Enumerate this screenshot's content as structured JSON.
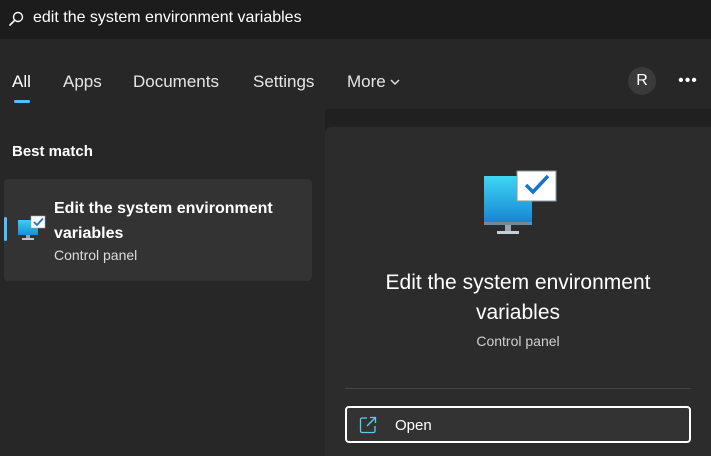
{
  "search": {
    "query": "edit the system environment variables",
    "icon": "search-icon"
  },
  "tabs": {
    "items": [
      {
        "label": "All",
        "active": true
      },
      {
        "label": "Apps",
        "active": false
      },
      {
        "label": "Documents",
        "active": false
      },
      {
        "label": "Settings",
        "active": false
      },
      {
        "label": "More",
        "active": false
      }
    ],
    "avatar_initial": "R",
    "more_options": "•••"
  },
  "results": {
    "section_title": "Best match",
    "best_match": {
      "title": "Edit the system environment variables",
      "subtitle": "Control panel",
      "icon": "monitor-check-icon"
    }
  },
  "detail": {
    "title": "Edit the system environment variables",
    "subtitle": "Control panel",
    "actions": [
      {
        "label": "Open",
        "icon": "open-external-icon"
      }
    ]
  },
  "colors": {
    "accent": "#4cc2ff",
    "background": "#202020",
    "pane": "#272727",
    "detail_pane": "#2c2c2c"
  }
}
